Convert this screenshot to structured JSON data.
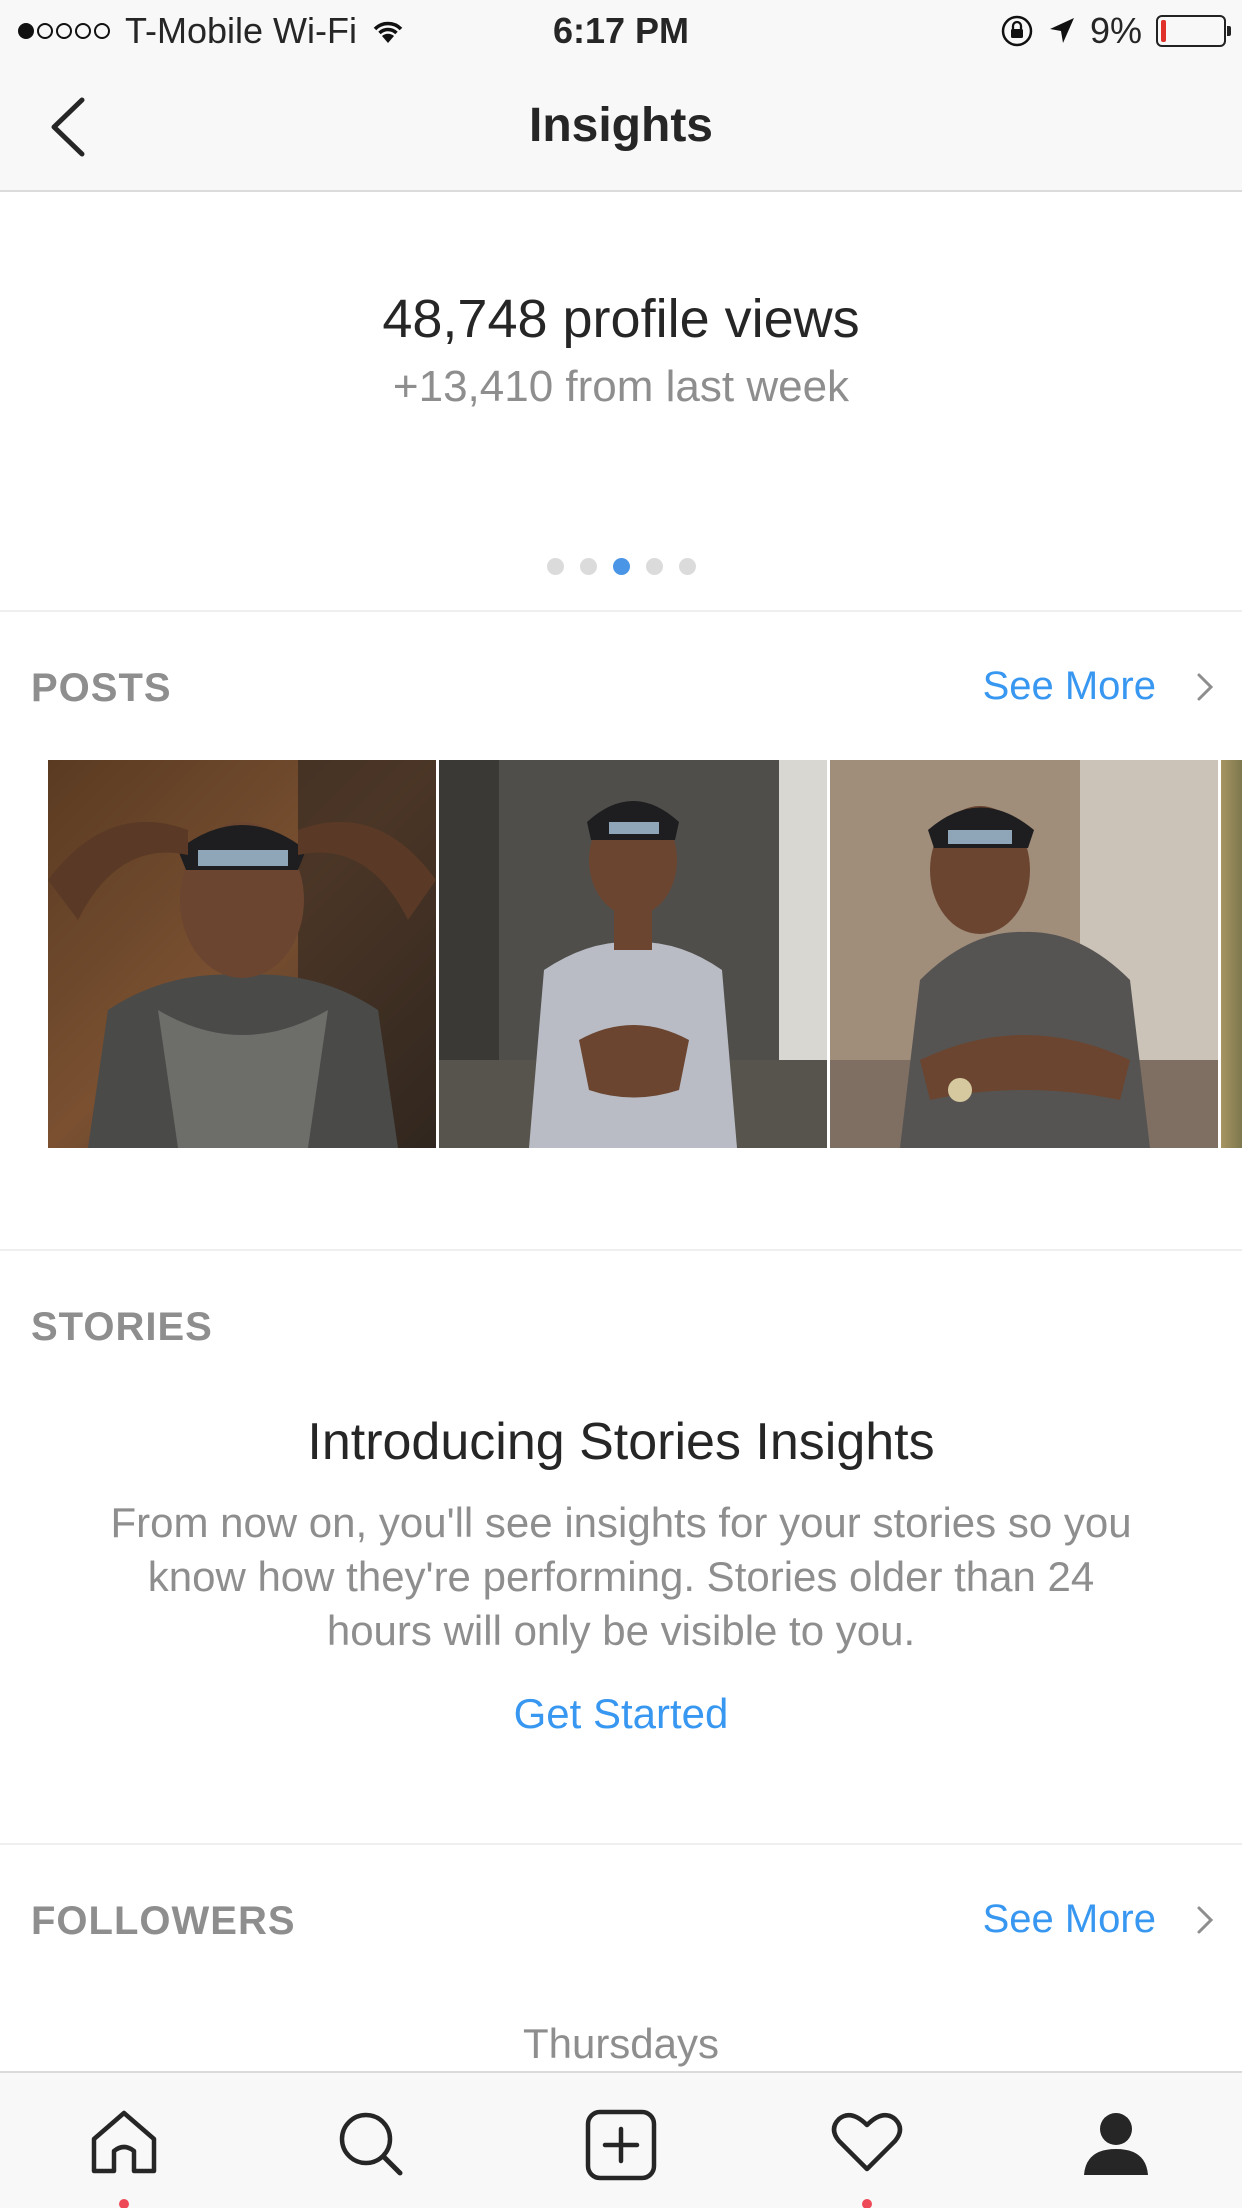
{
  "status_bar": {
    "carrier": "T-Mobile Wi-Fi",
    "time": "6:17 PM",
    "battery": "9%",
    "battery_level": 0.09,
    "signal_bars": 1,
    "icons": [
      "wifi-icon",
      "rotation-lock-icon",
      "location-arrow-icon",
      "battery-icon"
    ]
  },
  "nav": {
    "title": "Insights",
    "back_icon": "chevron-left-icon"
  },
  "profile_views": {
    "count_text": "48,748 profile views",
    "delta_text": "+13,410 from last week",
    "pager_total": 5,
    "pager_active_index": 2
  },
  "posts": {
    "label": "POSTS",
    "see_more": "See More"
  },
  "stories": {
    "label": "STORIES",
    "title": "Introducing Stories Insights",
    "body": "From now on, you'll see insights for your stories so you know how they're performing. Stories older than 24 hours will only be visible to you.",
    "cta": "Get Started"
  },
  "followers": {
    "label": "FOLLOWERS",
    "see_more": "See More",
    "top_day": "Thursdays"
  },
  "tab_bar": {
    "tabs": [
      {
        "icon": "home-icon",
        "badge": true
      },
      {
        "icon": "search-icon",
        "badge": false
      },
      {
        "icon": "add-post-icon",
        "badge": false
      },
      {
        "icon": "heart-icon",
        "badge": true
      },
      {
        "icon": "profile-icon",
        "badge": false
      }
    ]
  },
  "colors": {
    "accent": "#3897f0",
    "muted": "#8e8e8e",
    "text": "#262626",
    "badge": "#ed4956",
    "pager_active": "#4a95e6"
  }
}
